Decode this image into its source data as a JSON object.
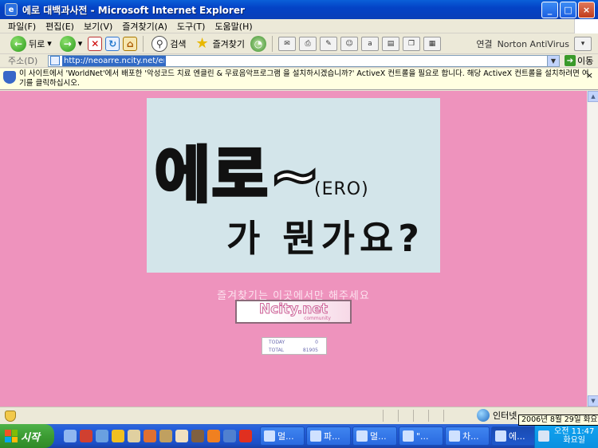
{
  "window": {
    "title": "에로 대백과사전 - Microsoft Internet Explorer",
    "app_icon": "e",
    "buttons": {
      "minimize": "_",
      "maximize": "□",
      "close": "×"
    }
  },
  "menu": [
    "파일(F)",
    "편집(E)",
    "보기(V)",
    "즐겨찾기(A)",
    "도구(T)",
    "도움말(H)"
  ],
  "toolbar": {
    "back": "뒤로",
    "search": "검색",
    "favorites": "즐겨찾기",
    "links": "연결",
    "norton": "Norton AntiVirus"
  },
  "address": {
    "label": "주소(D)",
    "url": "http://neoarre.ncity.net/erodic/",
    "go": "이동"
  },
  "infobar": {
    "message": "이 사이트에서 'WorldNet'에서 배포한 '악성코드 치료 엔클린 & 무료음악프로그램 을 설치하시겠습니까?' ActiveX 컨트롤을 필요로 합니다. 해당 ActiveX 컨트롤을 설치하려면 여기를 클릭하십시오.",
    "close": "×"
  },
  "content": {
    "banner_main": "에로~",
    "banner_ero": "(ERO)",
    "banner_sub": "가 뭔가요?",
    "favorite_text": "즐겨찾기는 이곳에서만 해주세요",
    "ncity_logo": "Ncity.net",
    "ncity_small": "community",
    "counter": {
      "today_label": "TODAY",
      "today_value": "0",
      "total_label": "TOTAL",
      "total_value": "81905"
    },
    "background_color": "#ee93bd",
    "banner_color": "#d3e5ea"
  },
  "status": {
    "zone": "인터넷",
    "date_tooltip": "2006년 8월 29일 화요일"
  },
  "taskbar": {
    "start": "시작",
    "tasks": [
      "멀...",
      "파...",
      "멀...",
      "\"...",
      "차...",
      "에..."
    ],
    "clock_time": "오전 11:47",
    "clock_day": "화요일"
  }
}
